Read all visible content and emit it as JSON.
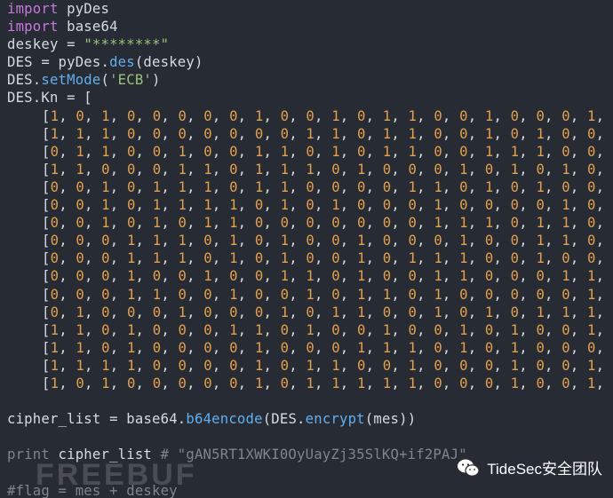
{
  "code": {
    "line1": {
      "kw": "import",
      "mod": "pyDes"
    },
    "line2": {
      "kw": "import",
      "mod": "base64"
    },
    "line3": {
      "var": "deskey",
      "op": "=",
      "str": "\"********\""
    },
    "line4": {
      "var": "DES",
      "op": "=",
      "obj": "pyDes.",
      "fn": "des",
      "arg": "(deskey)"
    },
    "line5": {
      "obj": "DES.",
      "fn": "setMode",
      "open": "(",
      "str": "'ECB'",
      "close": ")"
    },
    "line6": {
      "text": "DES.Kn = ["
    },
    "kn_rows": [
      "[1, 0, 1, 0, 0, 0, 0, 0, 1, 0, 0, 1, 0, 1, 1, 0, 0, 1, 0, 0, 0, 1,",
      "[1, 1, 1, 0, 0, 0, 0, 0, 0, 0, 1, 1, 0, 1, 1, 0, 0, 1, 0, 1, 0, 0,",
      "[0, 1, 1, 0, 0, 1, 0, 0, 1, 1, 0, 1, 0, 1, 1, 0, 0, 1, 1, 1, 0, 0,",
      "[1, 1, 0, 0, 0, 1, 1, 0, 1, 1, 1, 0, 1, 0, 0, 0, 1, 0, 1, 0, 1, 0,",
      "[0, 0, 1, 0, 1, 1, 1, 0, 1, 1, 0, 0, 0, 0, 1, 1, 0, 1, 0, 1, 0, 0,",
      "[0, 0, 1, 0, 1, 1, 1, 1, 0, 1, 0, 1, 0, 0, 0, 1, 0, 0, 0, 0, 1, 0,",
      "[0, 0, 1, 0, 1, 0, 1, 1, 0, 0, 0, 0, 0, 0, 0, 1, 1, 1, 0, 1, 1, 0,",
      "[0, 0, 0, 1, 1, 1, 0, 1, 0, 1, 0, 0, 1, 0, 0, 0, 1, 0, 0, 1, 1, 0,",
      "[0, 0, 0, 1, 1, 1, 0, 1, 0, 1, 0, 0, 1, 0, 1, 1, 1, 0, 0, 1, 0, 0,",
      "[0, 0, 0, 1, 0, 0, 1, 0, 0, 1, 1, 0, 1, 0, 0, 1, 1, 0, 0, 0, 1, 1,",
      "[0, 0, 0, 1, 1, 0, 0, 1, 0, 0, 1, 0, 1, 1, 0, 1, 0, 0, 0, 0, 0, 1,",
      "[0, 1, 0, 0, 0, 1, 0, 0, 0, 1, 0, 1, 1, 0, 0, 1, 0, 1, 0, 1, 1, 1,",
      "[1, 1, 0, 1, 0, 0, 0, 1, 1, 0, 1, 0, 0, 1, 0, 0, 1, 0, 1, 0, 0, 1,",
      "[1, 1, 0, 1, 0, 0, 0, 0, 1, 0, 0, 0, 1, 1, 1, 0, 1, 0, 1, 0, 0, 0,",
      "[1, 1, 1, 1, 0, 0, 0, 0, 1, 0, 1, 1, 0, 0, 1, 0, 0, 0, 1, 0, 0, 1,",
      "[1, 0, 1, 0, 0, 0, 0, 0, 1, 0, 1, 1, 1, 1, 1, 0, 0, 0, 1, 0, 0, 1,"
    ],
    "line_cipher": {
      "var": "cipher_list",
      "op": "=",
      "obj": "base64.",
      "fn": "b64encode",
      "open": "(DES.",
      "fn2": "encrypt",
      "close": "(mes))"
    },
    "line_print": {
      "kw": "print",
      "var": " cipher_list ",
      "comment": "# \"gAN5RT1XWKI0OyUayZj35SlKQ+if2PAJ\""
    },
    "line_flag": {
      "comment": "#flag = mes + deskey"
    }
  },
  "watermark": {
    "text": "FREEBUF"
  },
  "brand": {
    "name": "TideSec安全团队",
    "icon": "wechat-icon"
  },
  "colors": {
    "background": "#272b33",
    "keyword": "#c678dd",
    "string": "#98c379",
    "function": "#61afef",
    "number": "#e5a04a",
    "comment": "#7f848e"
  }
}
